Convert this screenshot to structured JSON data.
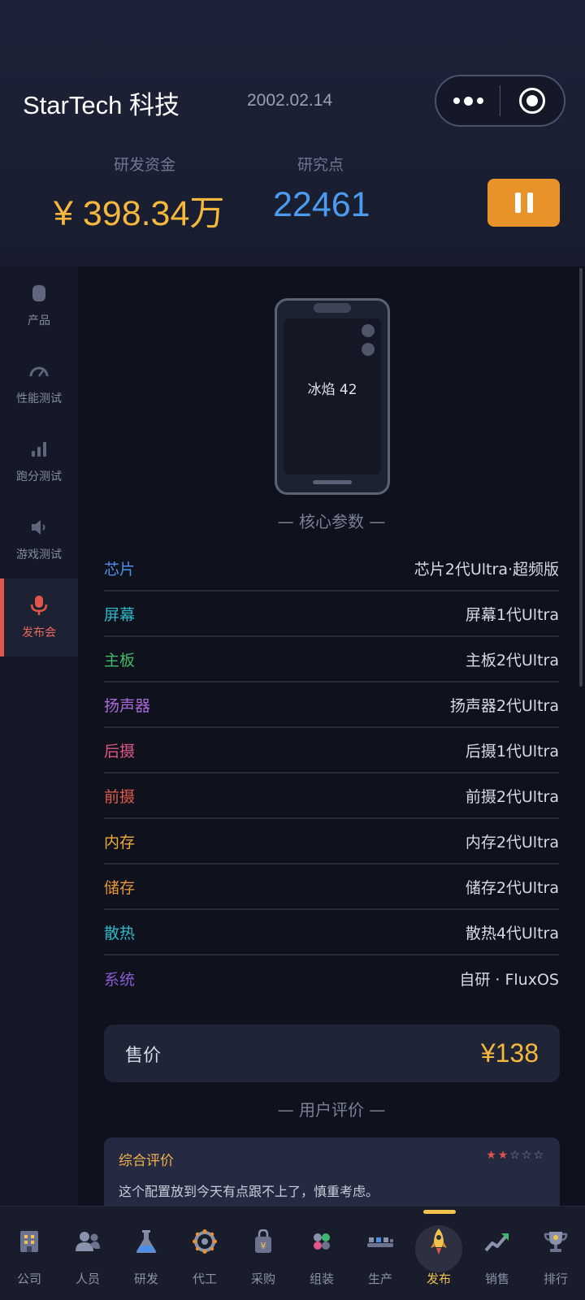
{
  "header": {
    "company": "StarTech 科技",
    "date": "2002.02.14",
    "funds_label": "研发资金",
    "funds_value": "¥ 398.34万",
    "points_label": "研究点",
    "points_value": "22461"
  },
  "sidebar": {
    "items": [
      {
        "label": "产品",
        "icon": "phone-icon"
      },
      {
        "label": "性能测试",
        "icon": "gauge-icon"
      },
      {
        "label": "跑分测试",
        "icon": "bar-chart-icon"
      },
      {
        "label": "游戏测试",
        "icon": "speaker-icon"
      },
      {
        "label": "发布会",
        "icon": "microphone-icon",
        "active": true
      }
    ]
  },
  "product": {
    "name": "冰焰 42",
    "core_title": "— 核心参数 —",
    "specs": [
      {
        "key": "芯片",
        "value": "芯片2代Ultra·超频版",
        "color": "#4c8fe8"
      },
      {
        "key": "屏幕",
        "value": "屏幕1代Ultra",
        "color": "#2bb8c9"
      },
      {
        "key": "主板",
        "value": "主板2代Ultra",
        "color": "#3fb86a"
      },
      {
        "key": "扬声器",
        "value": "扬声器2代Ultra",
        "color": "#a86ad8"
      },
      {
        "key": "后摄",
        "value": "后摄1代Ultra",
        "color": "#e0558a"
      },
      {
        "key": "前摄",
        "value": "前摄2代Ultra",
        "color": "#e05a4e"
      },
      {
        "key": "内存",
        "value": "内存2代Ultra",
        "color": "#f0a93c"
      },
      {
        "key": "储存",
        "value": "储存2代Ultra",
        "color": "#e8953a"
      },
      {
        "key": "散热",
        "value": "散热4代Ultra",
        "color": "#2bb8c9"
      },
      {
        "key": "系统",
        "value": "自研 · FluxOS",
        "color": "#8a5ad0"
      }
    ],
    "price_label": "售价",
    "price_value": "¥138",
    "reviews_title": "— 用户评价 —",
    "review": {
      "title": "综合评价",
      "rating": 2,
      "max_rating": 5,
      "text": "这个配置放到今天有点跟不上了，慎重考虑。"
    }
  },
  "tabbar": {
    "tabs": [
      {
        "label": "公司",
        "icon": "building-icon"
      },
      {
        "label": "人员",
        "icon": "people-icon"
      },
      {
        "label": "研发",
        "icon": "flask-icon"
      },
      {
        "label": "代工",
        "icon": "gear-icon"
      },
      {
        "label": "采购",
        "icon": "shopping-bag-icon"
      },
      {
        "label": "组装",
        "icon": "components-icon"
      },
      {
        "label": "生产",
        "icon": "factory-line-icon"
      },
      {
        "label": "发布",
        "icon": "rocket-icon",
        "active": true
      },
      {
        "label": "销售",
        "icon": "trend-up-icon"
      },
      {
        "label": "排行",
        "icon": "trophy-icon"
      }
    ]
  },
  "colors": {
    "accent_gold": "#f5b83d",
    "accent_blue": "#4c9bef",
    "pause_button": "#e8922a",
    "active_red": "#e0564a"
  }
}
